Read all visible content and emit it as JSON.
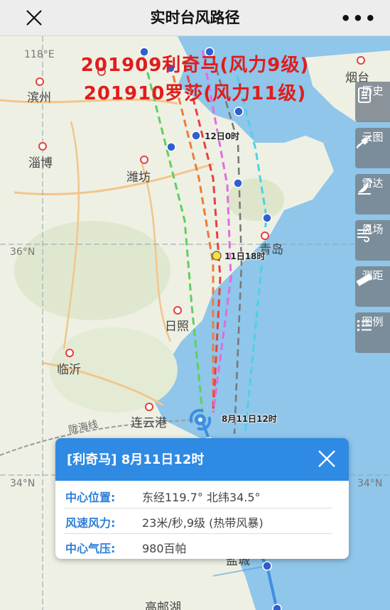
{
  "header": {
    "title": "实时台风路径",
    "close_icon": "close-icon",
    "more_label": "•••"
  },
  "headline": {
    "line1": "201909利奇马(风力9级)",
    "line2": "201910罗莎(风力11级)"
  },
  "grid": {
    "lon_118": "118°E",
    "lat_36_left": "36°N",
    "lat_34_left": "34°N",
    "lat_34_right": "34°N"
  },
  "cities": {
    "binzhou": "滨州",
    "zibo": "淄博",
    "weifang": "潍坊",
    "qingdao": "青岛",
    "rizhao": "日照",
    "linyi": "临沂",
    "lianyungang": "连云港",
    "yancheng": "盐城",
    "yantai": "烟台",
    "gaoyou": "高邮湖",
    "longhai": "陇海线"
  },
  "track_labels": {
    "t12_0": "12日0时",
    "t11_18": "11日18时",
    "t11_12": "8月11日12时"
  },
  "side_buttons": [
    {
      "label": "历史",
      "icon": "history-icon"
    },
    {
      "label": "云图",
      "icon": "satellite-icon"
    },
    {
      "label": "雷达",
      "icon": "radar-icon"
    },
    {
      "label": "风场",
      "icon": "wind-icon"
    },
    {
      "label": "测距",
      "icon": "ruler-icon"
    },
    {
      "label": "图例",
      "icon": "legend-icon"
    }
  ],
  "popup": {
    "title": "[利奇马] 8月11日12时",
    "rows": [
      {
        "key": "中心位置:",
        "value": "东经119.7°  北纬34.5°"
      },
      {
        "key": "风速风力:",
        "value": "23米/秒,9级 (热带风暴)"
      },
      {
        "key": "中心气压:",
        "value": "980百帕"
      }
    ]
  },
  "colors": {
    "accent": "#2f8ae3",
    "headline": "#e11c1c",
    "sea": "#8fc6ea",
    "land": "#eef2e6"
  }
}
